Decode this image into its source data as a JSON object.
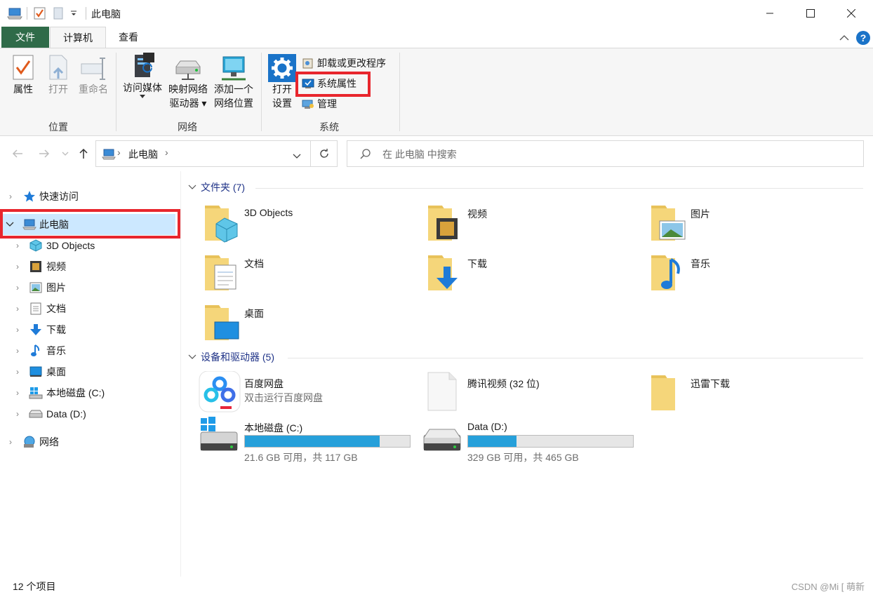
{
  "window": {
    "title": "此电脑",
    "controls": {
      "minimize": "minimize-icon",
      "maximize": "maximize-icon",
      "close": "close-icon"
    }
  },
  "ribbon": {
    "tabs": [
      {
        "label": "文件",
        "state": "file-tab"
      },
      {
        "label": "计算机",
        "state": "active"
      },
      {
        "label": "查看",
        "state": "inactive"
      }
    ],
    "groups": {
      "location": {
        "label": "位置",
        "buttons": [
          {
            "label": "属性",
            "icon": "properties-icon",
            "enabled": true
          },
          {
            "label": "打开",
            "icon": "open-icon",
            "enabled": false
          },
          {
            "label": "重命名",
            "icon": "rename-icon",
            "enabled": false
          }
        ]
      },
      "network": {
        "label": "网络",
        "buttons": [
          {
            "label": "访问媒体",
            "icon": "media-server-icon"
          },
          {
            "label_line1": "映射网络",
            "label_line2": "驱动器",
            "icon": "map-drive-icon"
          },
          {
            "label_line1": "添加一个",
            "label_line2": "网络位置",
            "icon": "network-location-icon"
          }
        ]
      },
      "system": {
        "label": "系统",
        "open_settings_line1": "打开",
        "open_settings_line2": "设置",
        "small_buttons": [
          {
            "label": "卸载或更改程序",
            "icon": "uninstall-icon"
          },
          {
            "label": "系统属性",
            "icon": "system-properties-icon",
            "highlighted": true
          },
          {
            "label": "管理",
            "icon": "manage-icon"
          }
        ]
      }
    }
  },
  "address_bar": {
    "crumb": "此电脑",
    "search_placeholder": "在 此电脑 中搜索"
  },
  "nav_pane": {
    "items": [
      {
        "label": "快速访问",
        "icon": "star-icon",
        "level": 0,
        "expanded": false
      },
      {
        "label": "此电脑",
        "icon": "this-pc-icon",
        "level": 0,
        "expanded": true,
        "selected": true
      },
      {
        "label": "3D Objects",
        "icon": "3d-objects-icon",
        "level": 1
      },
      {
        "label": "视频",
        "icon": "video-icon",
        "level": 1
      },
      {
        "label": "图片",
        "icon": "pictures-icon",
        "level": 1
      },
      {
        "label": "文档",
        "icon": "documents-icon",
        "level": 1
      },
      {
        "label": "下载",
        "icon": "download-icon",
        "level": 1
      },
      {
        "label": "音乐",
        "icon": "music-icon",
        "level": 1
      },
      {
        "label": "桌面",
        "icon": "desktop-icon",
        "level": 1
      },
      {
        "label": "本地磁盘 (C:)",
        "icon": "windows-drive-icon",
        "level": 1
      },
      {
        "label": "Data (D:)",
        "icon": "drive-icon",
        "level": 1
      },
      {
        "label": "网络",
        "icon": "network-icon",
        "level": 0
      }
    ]
  },
  "content": {
    "folders_header": "文件夹 (7)",
    "folders": [
      {
        "name": "3D Objects",
        "icon": "3d-objects-folder-icon"
      },
      {
        "name": "视频",
        "icon": "video-folder-icon"
      },
      {
        "name": "图片",
        "icon": "pictures-folder-icon"
      },
      {
        "name": "文档",
        "icon": "documents-folder-icon"
      },
      {
        "name": "下载",
        "icon": "download-folder-icon"
      },
      {
        "name": "音乐",
        "icon": "music-folder-icon"
      },
      {
        "name": "桌面",
        "icon": "desktop-folder-icon"
      }
    ],
    "devices_header": "设备和驱动器 (5)",
    "devices": [
      {
        "name": "百度网盘",
        "sub": "双击运行百度网盘",
        "icon": "baidu-netdisk-icon"
      },
      {
        "name": "腾讯视频 (32 位)",
        "icon": "blank-file-icon"
      },
      {
        "name": "迅雷下载",
        "icon": "folder-icon"
      }
    ],
    "drives": [
      {
        "name": "本地磁盘 (C:)",
        "usage": "21.6 GB 可用，共 117 GB",
        "used_fraction": 0.815,
        "icon": "windows-drive-icon"
      },
      {
        "name": "Data (D:)",
        "usage": "329 GB 可用，共 465 GB",
        "used_fraction": 0.292,
        "icon": "drive-icon"
      }
    ]
  },
  "status_bar": {
    "count": "12 个项目"
  },
  "watermark": "CSDN @Mi [ 萌新",
  "colors": {
    "accent": "#26a0da",
    "highlight": "#e8262d",
    "selection": "#cce8ff",
    "file_tab": "#2f6b49",
    "section_header": "#1e3287"
  }
}
